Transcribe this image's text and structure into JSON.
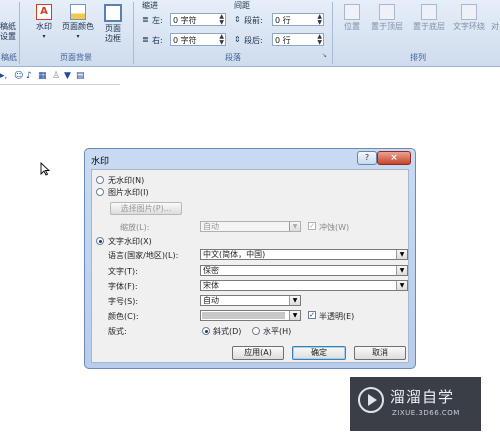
{
  "ribbon": {
    "left_partial": {
      "line1": "稿纸",
      "line2": "设置",
      "group": "稿纸"
    },
    "watermark_btn": "水印",
    "pagecolor_btn": "页面颜色",
    "border_btn_l1": "页面",
    "border_btn_l2": "边框",
    "page_bg_group": "页面背景",
    "indent_header": "缩进",
    "indent_left_label": "左:",
    "indent_left_value": "0 字符",
    "indent_right_label": "右:",
    "indent_right_value": "0 字符",
    "spacing_header": "间距",
    "spacing_before_label": "段前:",
    "spacing_before_value": "0 行",
    "spacing_after_label": "段后:",
    "spacing_after_value": "0 行",
    "paragraph_group": "段落",
    "position_btn": "位置",
    "bring_front_btn": "置于顶层",
    "send_back_btn": "置于底层",
    "text_wrap_btn": "文字环绕",
    "align_partial": "对",
    "arrange_group": "排列"
  },
  "dialog": {
    "title": "水印",
    "help_glyph": "?",
    "close_glyph": "×",
    "no_watermark": "无水印(N)",
    "picture_watermark": "图片水印(I)",
    "select_picture": "选择图片(P)...",
    "scale_label": "缩放(L):",
    "scale_value": "自动",
    "washout_label": "冲蚀(W)",
    "text_watermark": "文字水印(X)",
    "language_label": "语言(国家/地区)(L):",
    "language_value": "中文(简体，中国)",
    "text_label": "文字(T):",
    "text_value": "保密",
    "font_label": "字体(F):",
    "font_value": "宋体",
    "size_label": "字号(S):",
    "size_value": "自动",
    "color_label": "颜色(C):",
    "semitransparent_label": "半透明(E)",
    "layout_label": "版式:",
    "diagonal_label": "斜式(D)",
    "horizontal_label": "水平(H)",
    "apply_btn": "应用(A)",
    "ok_btn": "确定",
    "cancel_btn": "取消"
  },
  "brand": {
    "name": "溜溜自学",
    "url": "ZIXUE.3D66.COM"
  }
}
